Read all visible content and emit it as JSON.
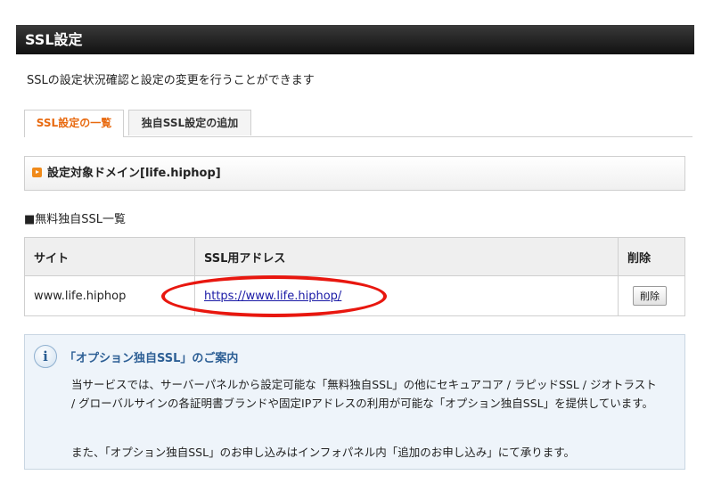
{
  "header": {
    "title": "SSL設定"
  },
  "description": "SSLの設定状況確認と設定の変更を行うことができます",
  "tabs": [
    {
      "label": "SSL設定の一覧",
      "active": true
    },
    {
      "label": "独自SSL設定の追加",
      "active": false
    }
  ],
  "domain_box": {
    "icon": "orange-arrow-square-icon",
    "label": "設定対象ドメイン[life.hiphop]"
  },
  "list_title": "■無料独自SSL一覧",
  "table": {
    "headers": [
      "サイト",
      "SSL用アドレス",
      "削除"
    ],
    "rows": [
      {
        "site": "www.life.hiphop",
        "ssl_address": "https://www.life.hiphop/",
        "delete_label": "削除"
      }
    ]
  },
  "info": {
    "icon": "info-icon",
    "title": "「オプション独自SSL」のご案内",
    "paragraph1": "当サービスでは、サーバーパネルから設定可能な「無料独自SSL」の他にセキュアコア / ラピッドSSL / ジオトラスト / グローバルサインの各証明書ブランドや固定IPアドレスの利用が可能な「オプション独自SSL」を提供しています。",
    "paragraph2": "また、「オプション独自SSL」のお申し込みはインフォパネル内「追加のお申し込み」にて承ります。"
  },
  "colors": {
    "accent": "#e86a10",
    "highlight_ring": "#e8170f",
    "info_title": "#2d5f95"
  }
}
